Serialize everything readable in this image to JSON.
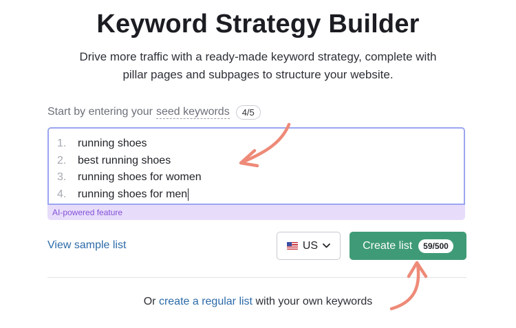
{
  "header": {
    "title": "Keyword Strategy Builder",
    "subtitle": "Drive more traffic with a ready-made keyword strategy, complete with pillar pages and subpages to structure your website."
  },
  "seed": {
    "label_prefix": "Start by entering your",
    "label_link": "seed keywords",
    "counter": "4/5"
  },
  "keywords": [
    {
      "num": "1.",
      "text": "running shoes"
    },
    {
      "num": "2.",
      "text": "best running shoes"
    },
    {
      "num": "3.",
      "text": "running shoes for women"
    },
    {
      "num": "4.",
      "text": "running shoes for men"
    }
  ],
  "ai_label": "AI-powered feature",
  "actions": {
    "view_sample": "View sample list",
    "country": "US",
    "create_label": "Create list",
    "create_counter": "59/500"
  },
  "footer": {
    "prefix": "Or",
    "link": "create a regular list",
    "suffix": "with your own keywords"
  },
  "colors": {
    "accent_green": "#3f9b77",
    "link_blue": "#2b6aa8",
    "ai_purple": "#8450d6",
    "annotation_arrow": "#ee8a78"
  },
  "icons": {
    "flag": "us-flag-icon",
    "chevron": "chevron-down-icon"
  }
}
